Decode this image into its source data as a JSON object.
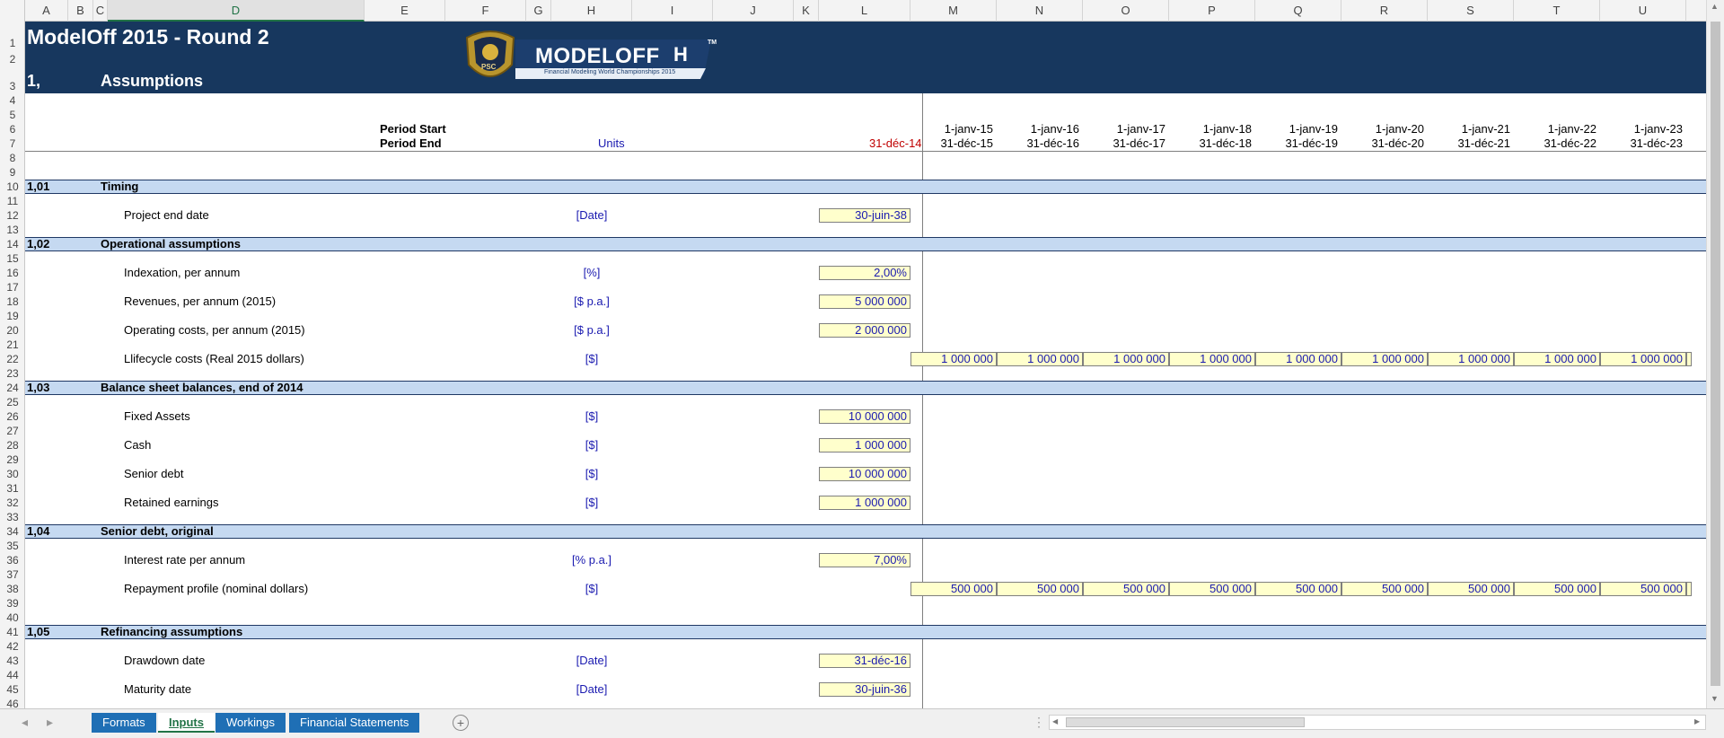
{
  "columns": [
    "A",
    "B",
    "C",
    "D",
    "E",
    "F",
    "G",
    "H",
    "I",
    "J",
    "K",
    "L",
    "M",
    "N",
    "O",
    "P",
    "Q",
    "R",
    "S",
    "T",
    "U"
  ],
  "selected_column": "D",
  "rows": [
    "1",
    "2",
    "3",
    "4",
    "5",
    "6",
    "7",
    "8",
    "9",
    "10",
    "11",
    "12",
    "13",
    "14",
    "15",
    "16",
    "17",
    "18",
    "19",
    "20",
    "21",
    "22",
    "23",
    "24",
    "25",
    "26",
    "27",
    "28",
    "29",
    "30",
    "31",
    "32",
    "33",
    "34",
    "35",
    "36",
    "37",
    "38",
    "39",
    "40",
    "41",
    "42",
    "43",
    "44",
    "45",
    "46"
  ],
  "banner": {
    "title": "ModelOff 2015 - Round 2",
    "section_num": "1,",
    "section_title": "Assumptions",
    "logo_word": "MODELOFF",
    "logo_sub": "Financial Modeling World Championships 2015",
    "logo_badge": "PSC",
    "logo_tm": "TM"
  },
  "header": {
    "period_start_label": "Period Start",
    "period_end_label": "Period End",
    "units_label": "Units",
    "base_date": "31-déc-14",
    "period_starts": [
      "1-janv-15",
      "1-janv-16",
      "1-janv-17",
      "1-janv-18",
      "1-janv-19",
      "1-janv-20",
      "1-janv-21",
      "1-janv-22",
      "1-janv-23"
    ],
    "period_ends": [
      "31-déc-15",
      "31-déc-16",
      "31-déc-17",
      "31-déc-18",
      "31-déc-19",
      "31-déc-20",
      "31-déc-21",
      "31-déc-22",
      "31-déc-23"
    ]
  },
  "sections": [
    {
      "num": "1,01",
      "title": "Timing"
    },
    {
      "num": "1,02",
      "title": "Operational assumptions"
    },
    {
      "num": "1,03",
      "title": "Balance sheet balances, end of 2014"
    },
    {
      "num": "1,04",
      "title": "Senior debt, original"
    },
    {
      "num": "1,05",
      "title": "Refinancing assumptions"
    }
  ],
  "items": [
    {
      "label": "Project end date",
      "unit": "[Date]",
      "value": "30-juin-38"
    },
    {
      "label": "Indexation, per annum",
      "unit": "[%]",
      "value": "2,00%"
    },
    {
      "label": "Revenues, per annum (2015)",
      "unit": "[$ p.a.]",
      "value": "5 000 000"
    },
    {
      "label": "Operating costs, per annum (2015)",
      "unit": "[$ p.a.]",
      "value": "2 000 000"
    },
    {
      "label": "Llifecycle costs (Real 2015 dollars)",
      "unit": "[$]",
      "value": ""
    },
    {
      "label": "Fixed Assets",
      "unit": "[$]",
      "value": "10 000 000"
    },
    {
      "label": "Cash",
      "unit": "[$]",
      "value": "1 000 000"
    },
    {
      "label": "Senior debt",
      "unit": "[$]",
      "value": "10 000 000"
    },
    {
      "label": "Retained earnings",
      "unit": "[$]",
      "value": "1 000 000"
    },
    {
      "label": "Interest rate per annum",
      "unit": "[% p.a.]",
      "value": "7,00%"
    },
    {
      "label": "Repayment profile (nominal dollars)",
      "unit": "[$]",
      "value": ""
    },
    {
      "label": "Drawdown date",
      "unit": "[Date]",
      "value": "31-déc-16"
    },
    {
      "label": "Maturity date",
      "unit": "[Date]",
      "value": "30-juin-36"
    }
  ],
  "lifecycle_values": [
    "1 000 000",
    "1 000 000",
    "1 000 000",
    "1 000 000",
    "1 000 000",
    "1 000 000",
    "1 000 000",
    "1 000 000",
    "1 000 000"
  ],
  "repayment_values": [
    "500 000",
    "500 000",
    "500 000",
    "500 000",
    "500 000",
    "500 000",
    "500 000",
    "500 000",
    "500 000"
  ],
  "tabs": [
    "Formats",
    "Inputs",
    "Workings",
    "Financial Statements"
  ],
  "active_tab": "Inputs",
  "scroll_glyphs": {
    "up": "▲",
    "down": "▼",
    "left": "◀",
    "right": "▶",
    "tab_prev": "◂",
    "tab_next": "▸",
    "add": "+",
    "dots": "⋮"
  },
  "colors": {
    "banner": "#17375e",
    "section": "#c5d9f1",
    "input_fill": "#ffffcc",
    "input_text": "#1a1ab0",
    "base_date": "#c00000",
    "tab": "#1f6fb5"
  }
}
